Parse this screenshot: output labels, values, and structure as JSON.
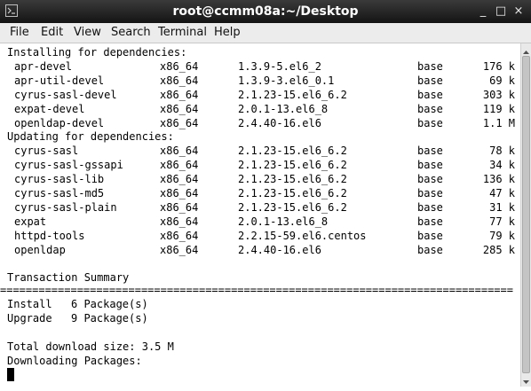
{
  "window": {
    "title": "root@ccmm08a:~/Desktop",
    "minimize_glyph": "_",
    "maximize_glyph": "□",
    "close_glyph": "×"
  },
  "menu": [
    "File",
    "Edit",
    "View",
    "Search",
    "Terminal",
    "Help"
  ],
  "install_header": "Installing for dependencies:",
  "install_rows": [
    {
      "name": "apr-devel",
      "arch": "x86_64",
      "version": "1.3.9-5.el6_2",
      "repo": "base",
      "size": "176 k"
    },
    {
      "name": "apr-util-devel",
      "arch": "x86_64",
      "version": "1.3.9-3.el6_0.1",
      "repo": "base",
      "size": "69 k"
    },
    {
      "name": "cyrus-sasl-devel",
      "arch": "x86_64",
      "version": "2.1.23-15.el6_6.2",
      "repo": "base",
      "size": "303 k"
    },
    {
      "name": "expat-devel",
      "arch": "x86_64",
      "version": "2.0.1-13.el6_8",
      "repo": "base",
      "size": "119 k"
    },
    {
      "name": "openldap-devel",
      "arch": "x86_64",
      "version": "2.4.40-16.el6",
      "repo": "base",
      "size": "1.1 M"
    }
  ],
  "update_header": "Updating for dependencies:",
  "update_rows": [
    {
      "name": "cyrus-sasl",
      "arch": "x86_64",
      "version": "2.1.23-15.el6_6.2",
      "repo": "base",
      "size": "78 k"
    },
    {
      "name": "cyrus-sasl-gssapi",
      "arch": "x86_64",
      "version": "2.1.23-15.el6_6.2",
      "repo": "base",
      "size": "34 k"
    },
    {
      "name": "cyrus-sasl-lib",
      "arch": "x86_64",
      "version": "2.1.23-15.el6_6.2",
      "repo": "base",
      "size": "136 k"
    },
    {
      "name": "cyrus-sasl-md5",
      "arch": "x86_64",
      "version": "2.1.23-15.el6_6.2",
      "repo": "base",
      "size": "47 k"
    },
    {
      "name": "cyrus-sasl-plain",
      "arch": "x86_64",
      "version": "2.1.23-15.el6_6.2",
      "repo": "base",
      "size": "31 k"
    },
    {
      "name": "expat",
      "arch": "x86_64",
      "version": "2.0.1-13.el6_8",
      "repo": "base",
      "size": "77 k"
    },
    {
      "name": "httpd-tools",
      "arch": "x86_64",
      "version": "2.2.15-59.el6.centos",
      "repo": "base",
      "size": "79 k"
    },
    {
      "name": "openldap",
      "arch": "x86_64",
      "version": "2.4.40-16.el6",
      "repo": "base",
      "size": "285 k"
    }
  ],
  "summary_title": "Transaction Summary",
  "separator": "================================================================================",
  "summary": [
    {
      "label": "Install",
      "count": "6 Package(s)"
    },
    {
      "label": "Upgrade",
      "count": "9 Package(s)"
    }
  ],
  "total_download": "Total download size: 3.5 M",
  "downloading": "Downloading Packages:"
}
